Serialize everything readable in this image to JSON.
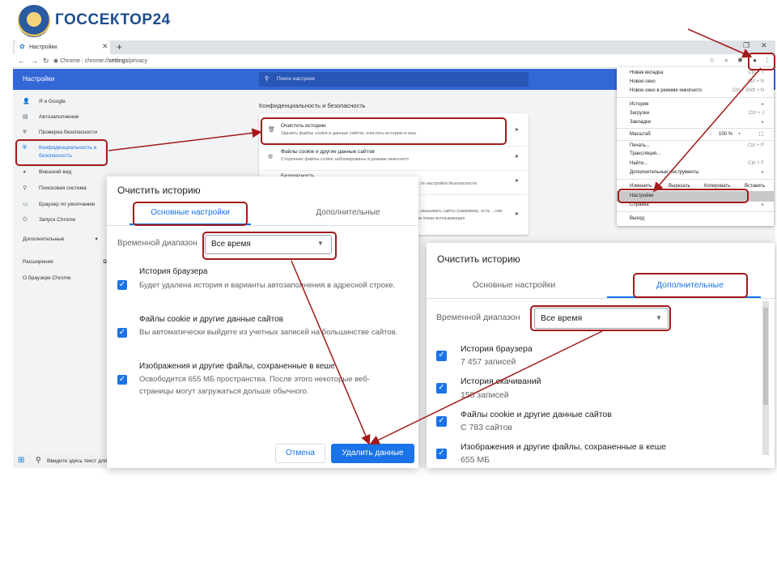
{
  "brand": {
    "name": "ГОССЕКТОР24"
  },
  "browser": {
    "tab_title": "Настройки",
    "url_host": "Chrome",
    "url_path_pre": "chrome://",
    "url_path_main": "settings",
    "url_path_post": "/privacy",
    "new_tab": "+",
    "close": "✕"
  },
  "settings": {
    "header_title": "Настройки",
    "search_placeholder": "Поиск настроек",
    "sidebar": {
      "items": [
        {
          "label": "Я и Google",
          "icon": "person-icon"
        },
        {
          "label": "Автозаполнение",
          "icon": "clipboard-icon"
        },
        {
          "label": "Проверка безопасности",
          "icon": "shield-check-icon"
        },
        {
          "label": "Конфиденциальность и безопасность",
          "icon": "shield-icon"
        },
        {
          "label": "Внешний вид",
          "icon": "palette-icon"
        },
        {
          "label": "Поисковая система",
          "icon": "search-icon"
        },
        {
          "label": "Браузер по умолчанию",
          "icon": "browser-icon"
        },
        {
          "label": "Запуск Chrome",
          "icon": "power-icon"
        }
      ],
      "advanced": "Дополнительные",
      "extensions": "Расширения",
      "about": "О браузере Chrome"
    },
    "section_title": "Конфиденциальность и безопасность",
    "privacy_rows": [
      {
        "title": "Очистить историю",
        "subtitle": "Удалить файлы cookie и данные сайтов, очистить историю и кеш"
      },
      {
        "title": "Файлы cookie и другие данные сайтов",
        "subtitle": "Сторонние файлы cookie заблокированы в режиме инкогнито"
      },
      {
        "title": "Безопасность",
        "subtitle": "...те настройки безопасности"
      },
      {
        "title": "",
        "subtitle": "...оказывать сайты (например, есть ...ние на показ всплывающих"
      }
    ]
  },
  "chrome_menu": {
    "items": [
      {
        "label": "Новая вкладка",
        "shortcut": "Ctrl + T"
      },
      {
        "label": "Новое окно",
        "shortcut": "Ctrl + N"
      },
      {
        "label": "Новое окно в режиме инкогнито",
        "shortcut": "Ctrl + Shift + N"
      },
      {
        "label": "История",
        "shortcut": "▸"
      },
      {
        "label": "Загрузки",
        "shortcut": "Ctrl + J"
      },
      {
        "label": "Закладки",
        "shortcut": "▸"
      },
      {
        "label": "Печать...",
        "shortcut": "Ctrl + P"
      },
      {
        "label": "Трансляция...",
        "shortcut": ""
      },
      {
        "label": "Найти...",
        "shortcut": "Ctrl + F"
      },
      {
        "label": "Дополнительные инструменты",
        "shortcut": "▸"
      },
      {
        "label": "Справка",
        "shortcut": "▸"
      },
      {
        "label": "Выход",
        "shortcut": ""
      }
    ],
    "zoom_label": "Масштаб",
    "zoom_minus": "−",
    "zoom_value": "100 %",
    "zoom_plus": "+",
    "edit_label": "Изменить",
    "cut": "Вырезать",
    "copy": "Копировать",
    "paste": "Вставить",
    "settings": "Настройки"
  },
  "taskbar": {
    "search_placeholder": "Введите здесь текст для поиска"
  },
  "clear_dialog_basic": {
    "title": "Очистить историю",
    "tab_basic": "Основные настройки",
    "tab_advanced": "Дополнительные",
    "time_range_label": "Временной диапазон",
    "time_range_value": "Все время",
    "options": [
      {
        "title": "История браузера",
        "desc": "Будет удалена история и варианты автозаполнения в адресной строке.",
        "checked": true
      },
      {
        "title": "Файлы cookie и другие данные сайтов",
        "desc": "Вы автоматически выйдете из учетных записей на большинстве сайтов.",
        "checked": true
      },
      {
        "title": "Изображения и другие файлы, сохраненные в кеше",
        "desc": "Освободится 655 МБ пространства. После этого некоторые веб-страницы могут загружаться дольше обычного.",
        "checked": true
      }
    ],
    "cancel": "Отмена",
    "delete": "Удалить данные"
  },
  "clear_dialog_advanced": {
    "title": "Очистить историю",
    "tab_basic": "Основные настройки",
    "tab_advanced": "Дополнительные",
    "time_range_label": "Временной диапазон",
    "time_range_value": "Все время",
    "options": [
      {
        "title": "История браузера",
        "desc": "7 457 записей",
        "checked": true
      },
      {
        "title": "История скачиваний",
        "desc": "158 записей",
        "checked": true
      },
      {
        "title": "Файлы cookie и другие данные сайтов",
        "desc": "С 783 сайтов",
        "checked": true
      },
      {
        "title": "Изображения и другие файлы, сохраненные в кеше",
        "desc": "655 МБ",
        "checked": true
      }
    ]
  },
  "colors": {
    "accent": "#1a73e8",
    "header": "#3367d6",
    "highlight": "#a31a1a",
    "brand": "#1f4e8c"
  }
}
